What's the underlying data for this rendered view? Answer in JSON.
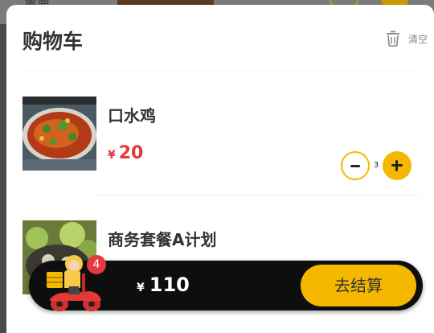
{
  "background_page": {
    "partial_text": "重要"
  },
  "cart": {
    "title": "购物车",
    "clear_label": "清空",
    "items": [
      {
        "name": "口水鸡",
        "price_symbol": "¥",
        "price": "20",
        "quantity": "3",
        "image_icon": "spicy-chicken-photo"
      },
      {
        "name": "商务套餐A计划",
        "image_icon": "set-meal-photo"
      }
    ]
  },
  "bottom_bar": {
    "badge_count": "4",
    "total_symbol": "¥",
    "total": "110",
    "checkout_label": "去结算"
  },
  "colors": {
    "accent": "#f5b800",
    "price": "#e4393c",
    "bar": "#0e0e0e",
    "badge": "#e4393c"
  }
}
